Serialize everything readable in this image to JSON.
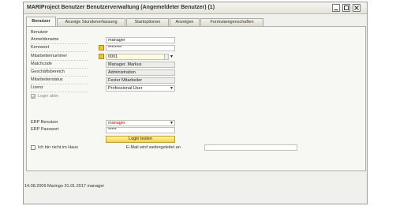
{
  "window": {
    "title": "MARIProject Benutzer Benutzerverwaltung (Angemeldeter Benutzer) (1)"
  },
  "tabs": [
    {
      "label": "Benutzer"
    },
    {
      "label": "Anzeige Stundenerfassung"
    },
    {
      "label": "Startoptionen"
    },
    {
      "label": "Anzeigen"
    },
    {
      "label": "Formularegenschaften"
    }
  ],
  "section": {
    "title": "Benutzer"
  },
  "fields": {
    "anmeldename": {
      "label": "Anmeldename",
      "value": "manager"
    },
    "kennwort": {
      "label": "Kennwort",
      "value": "********"
    },
    "mitarbeiternummer": {
      "label": "Mitarbeiternummer",
      "value": "0001"
    },
    "matchcode": {
      "label": "Matchcode",
      "value": "Manager, Markus"
    },
    "geschaeftsbereich": {
      "label": "Geschäftsbereich",
      "value": "Administration"
    },
    "mitarbeiterstatus": {
      "label": "Mitarbeiterstatus",
      "value": "Fester Mitarbeiter"
    },
    "lizenz": {
      "label": "Lizenz",
      "value": "Professional User"
    },
    "login_aktiv": {
      "label": "Login aktiv"
    }
  },
  "erp": {
    "benutzer": {
      "label": "ERP Benutzer",
      "value": "manager"
    },
    "passwort": {
      "label": "ERP Passwort",
      "value": "*****"
    },
    "login_button": "Login testen"
  },
  "absence": {
    "checkbox_label": "Ich bin nicht im Haus",
    "email_label": "E-Mail wird weitergeleitet an",
    "email_value": ""
  },
  "footer": {
    "text": "14.08.2009 Maringo  31.01.2017 manager"
  },
  "colors": {
    "accent_field": "#fffbe0",
    "button": "#f2d24a",
    "erp_user_text": "#cc0000"
  }
}
